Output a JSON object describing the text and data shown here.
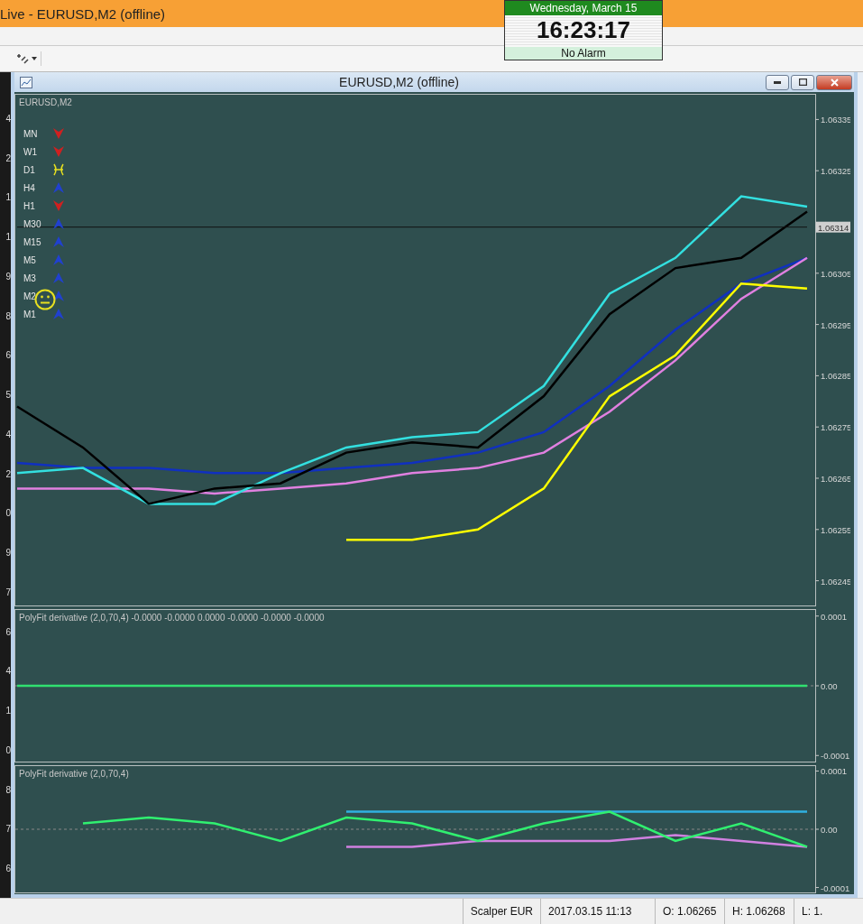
{
  "app": {
    "title": "Live - EURUSD,M2 (offline)"
  },
  "clock": {
    "date": "Wednesday, March 15",
    "time": "16:23:17",
    "alarm": "No Alarm"
  },
  "background_axis_fragments": [
    "4",
    "2",
    "1",
    "1",
    "9",
    "8",
    "6",
    "5",
    "4",
    "2",
    "0",
    "9",
    "7",
    "6",
    "4",
    "1",
    "0",
    "8",
    "7",
    "6"
  ],
  "chart_window": {
    "title": "EURUSD,M2 (offline)",
    "main_panel": {
      "symbol": "EURUSD,M2",
      "legend": [
        {
          "label": "MN",
          "kind": "down"
        },
        {
          "label": "W1",
          "kind": "down"
        },
        {
          "label": "D1",
          "kind": "flat"
        },
        {
          "label": "H4",
          "kind": "up"
        },
        {
          "label": "H1",
          "kind": "down"
        },
        {
          "label": "M30",
          "kind": "up"
        },
        {
          "label": "M15",
          "kind": "up"
        },
        {
          "label": "M5",
          "kind": "up"
        },
        {
          "label": "M3",
          "kind": "up"
        },
        {
          "label": "M2",
          "kind": "up"
        },
        {
          "label": "M1",
          "kind": "up"
        }
      ],
      "chart_data": {
        "type": "line",
        "ylim": [
          1.0624,
          1.0634
        ],
        "yticks": [
          1.06335,
          1.06325,
          1.06305,
          1.06295,
          1.06285,
          1.06275,
          1.06265,
          1.06255,
          1.06245
        ],
        "series": [
          {
            "color": "#1030c0",
            "values": [
              1.06268,
              1.06267,
              1.06267,
              1.06266,
              1.06266,
              1.06267,
              1.06268,
              1.0627,
              1.06274,
              1.06283,
              1.06294,
              1.06303,
              1.06308
            ]
          },
          {
            "color": "#e080e0",
            "values": [
              1.06263,
              1.06263,
              1.06263,
              1.06262,
              1.06263,
              1.06264,
              1.06266,
              1.06267,
              1.0627,
              1.06278,
              1.06288,
              1.063,
              1.06308
            ]
          },
          {
            "color": "#ffff00",
            "values": [
              null,
              null,
              null,
              null,
              null,
              1.06253,
              1.06253,
              1.06255,
              1.06263,
              1.06281,
              1.06289,
              1.06303,
              1.06302
            ]
          },
          {
            "color": "#33e0e0",
            "values": [
              1.06266,
              1.06267,
              1.0626,
              1.0626,
              1.06266,
              1.06271,
              1.06273,
              1.06274,
              1.06283,
              1.06301,
              1.06308,
              1.0632,
              1.06318
            ]
          },
          {
            "color": "#000000",
            "values": [
              1.06279,
              1.06271,
              1.0626,
              1.06263,
              1.06264,
              1.0627,
              1.06272,
              1.06271,
              1.06281,
              1.06297,
              1.06306,
              1.06308,
              1.06317
            ]
          },
          {
            "color": "#111111",
            "values": [
              1.06314,
              1.06314,
              1.06314,
              1.06314,
              1.06314,
              1.06314,
              1.06314,
              1.06314,
              1.06314,
              1.06314,
              1.06314,
              1.06314,
              1.06314
            ]
          }
        ]
      },
      "price_tag": "1.06314"
    },
    "sub_panels": [
      {
        "title": "PolyFit derivative (2,0,70,4) -0.0000 -0.0000 0.0000 -0.0000 -0.0000 -0.0000",
        "chart_data": {
          "type": "line",
          "ylim": [
            -0.00011,
            0.00011
          ],
          "yticks": [
            {
              "value": 0.0001,
              "label": "0.0001"
            },
            {
              "value": 0,
              "label": "0.00"
            },
            {
              "value": -0.0001,
              "label": "-0.0001"
            }
          ],
          "series": [
            {
              "color": "#30e070",
              "values": [
                0,
                0,
                0,
                0,
                0,
                0,
                0,
                0,
                0,
                0,
                0,
                0,
                0
              ]
            }
          ]
        }
      },
      {
        "title": "PolyFit derivative (2,0,70,4)",
        "chart_data": {
          "type": "line",
          "ylim": [
            -0.00011,
            0.00011
          ],
          "yticks": [
            {
              "value": 0.0001,
              "label": "0.0001"
            },
            {
              "value": 0,
              "label": "0.00"
            },
            {
              "value": -0.0001,
              "label": "-0.0001"
            }
          ],
          "series": [
            {
              "color": "#30b0e0",
              "values": [
                null,
                null,
                null,
                null,
                null,
                3e-05,
                3e-05,
                3e-05,
                3e-05,
                3e-05,
                3e-05,
                3e-05,
                3e-05
              ]
            },
            {
              "color": "#d080e0",
              "values": [
                null,
                null,
                null,
                null,
                null,
                -3e-05,
                -3e-05,
                -2e-05,
                -2e-05,
                -2e-05,
                -1e-05,
                -2e-05,
                -3e-05
              ]
            },
            {
              "color": "#30f070",
              "values": [
                null,
                1e-05,
                2e-05,
                1e-05,
                -2e-05,
                2e-05,
                1e-05,
                -2e-05,
                1e-05,
                3e-05,
                -2e-05,
                1e-05,
                -3e-05
              ]
            }
          ]
        }
      }
    ]
  },
  "status_bar": [
    "Scalper EUR",
    "2017.03.15 11:13",
    "O: 1.06265",
    "H: 1.06268",
    "L: 1."
  ]
}
